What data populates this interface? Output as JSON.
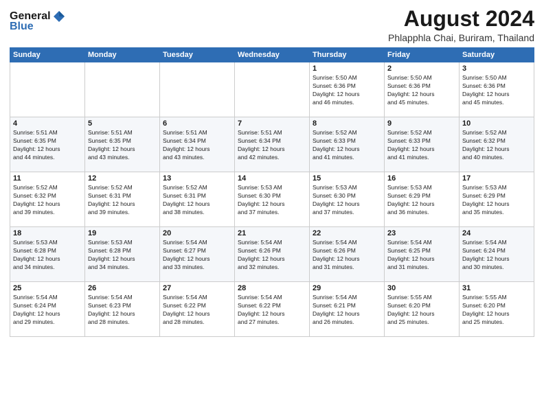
{
  "logo": {
    "general": "General",
    "blue": "Blue"
  },
  "title": "August 2024",
  "subtitle": "Phlapphla Chai, Buriram, Thailand",
  "days_of_week": [
    "Sunday",
    "Monday",
    "Tuesday",
    "Wednesday",
    "Thursday",
    "Friday",
    "Saturday"
  ],
  "weeks": [
    [
      {
        "day": "",
        "info": ""
      },
      {
        "day": "",
        "info": ""
      },
      {
        "day": "",
        "info": ""
      },
      {
        "day": "",
        "info": ""
      },
      {
        "day": "1",
        "info": "Sunrise: 5:50 AM\nSunset: 6:36 PM\nDaylight: 12 hours\nand 46 minutes."
      },
      {
        "day": "2",
        "info": "Sunrise: 5:50 AM\nSunset: 6:36 PM\nDaylight: 12 hours\nand 45 minutes."
      },
      {
        "day": "3",
        "info": "Sunrise: 5:50 AM\nSunset: 6:36 PM\nDaylight: 12 hours\nand 45 minutes."
      }
    ],
    [
      {
        "day": "4",
        "info": "Sunrise: 5:51 AM\nSunset: 6:35 PM\nDaylight: 12 hours\nand 44 minutes."
      },
      {
        "day": "5",
        "info": "Sunrise: 5:51 AM\nSunset: 6:35 PM\nDaylight: 12 hours\nand 43 minutes."
      },
      {
        "day": "6",
        "info": "Sunrise: 5:51 AM\nSunset: 6:34 PM\nDaylight: 12 hours\nand 43 minutes."
      },
      {
        "day": "7",
        "info": "Sunrise: 5:51 AM\nSunset: 6:34 PM\nDaylight: 12 hours\nand 42 minutes."
      },
      {
        "day": "8",
        "info": "Sunrise: 5:52 AM\nSunset: 6:33 PM\nDaylight: 12 hours\nand 41 minutes."
      },
      {
        "day": "9",
        "info": "Sunrise: 5:52 AM\nSunset: 6:33 PM\nDaylight: 12 hours\nand 41 minutes."
      },
      {
        "day": "10",
        "info": "Sunrise: 5:52 AM\nSunset: 6:32 PM\nDaylight: 12 hours\nand 40 minutes."
      }
    ],
    [
      {
        "day": "11",
        "info": "Sunrise: 5:52 AM\nSunset: 6:32 PM\nDaylight: 12 hours\nand 39 minutes."
      },
      {
        "day": "12",
        "info": "Sunrise: 5:52 AM\nSunset: 6:31 PM\nDaylight: 12 hours\nand 39 minutes."
      },
      {
        "day": "13",
        "info": "Sunrise: 5:52 AM\nSunset: 6:31 PM\nDaylight: 12 hours\nand 38 minutes."
      },
      {
        "day": "14",
        "info": "Sunrise: 5:53 AM\nSunset: 6:30 PM\nDaylight: 12 hours\nand 37 minutes."
      },
      {
        "day": "15",
        "info": "Sunrise: 5:53 AM\nSunset: 6:30 PM\nDaylight: 12 hours\nand 37 minutes."
      },
      {
        "day": "16",
        "info": "Sunrise: 5:53 AM\nSunset: 6:29 PM\nDaylight: 12 hours\nand 36 minutes."
      },
      {
        "day": "17",
        "info": "Sunrise: 5:53 AM\nSunset: 6:29 PM\nDaylight: 12 hours\nand 35 minutes."
      }
    ],
    [
      {
        "day": "18",
        "info": "Sunrise: 5:53 AM\nSunset: 6:28 PM\nDaylight: 12 hours\nand 34 minutes."
      },
      {
        "day": "19",
        "info": "Sunrise: 5:53 AM\nSunset: 6:28 PM\nDaylight: 12 hours\nand 34 minutes."
      },
      {
        "day": "20",
        "info": "Sunrise: 5:54 AM\nSunset: 6:27 PM\nDaylight: 12 hours\nand 33 minutes."
      },
      {
        "day": "21",
        "info": "Sunrise: 5:54 AM\nSunset: 6:26 PM\nDaylight: 12 hours\nand 32 minutes."
      },
      {
        "day": "22",
        "info": "Sunrise: 5:54 AM\nSunset: 6:26 PM\nDaylight: 12 hours\nand 31 minutes."
      },
      {
        "day": "23",
        "info": "Sunrise: 5:54 AM\nSunset: 6:25 PM\nDaylight: 12 hours\nand 31 minutes."
      },
      {
        "day": "24",
        "info": "Sunrise: 5:54 AM\nSunset: 6:24 PM\nDaylight: 12 hours\nand 30 minutes."
      }
    ],
    [
      {
        "day": "25",
        "info": "Sunrise: 5:54 AM\nSunset: 6:24 PM\nDaylight: 12 hours\nand 29 minutes."
      },
      {
        "day": "26",
        "info": "Sunrise: 5:54 AM\nSunset: 6:23 PM\nDaylight: 12 hours\nand 28 minutes."
      },
      {
        "day": "27",
        "info": "Sunrise: 5:54 AM\nSunset: 6:22 PM\nDaylight: 12 hours\nand 28 minutes."
      },
      {
        "day": "28",
        "info": "Sunrise: 5:54 AM\nSunset: 6:22 PM\nDaylight: 12 hours\nand 27 minutes."
      },
      {
        "day": "29",
        "info": "Sunrise: 5:54 AM\nSunset: 6:21 PM\nDaylight: 12 hours\nand 26 minutes."
      },
      {
        "day": "30",
        "info": "Sunrise: 5:55 AM\nSunset: 6:20 PM\nDaylight: 12 hours\nand 25 minutes."
      },
      {
        "day": "31",
        "info": "Sunrise: 5:55 AM\nSunset: 6:20 PM\nDaylight: 12 hours\nand 25 minutes."
      }
    ]
  ]
}
